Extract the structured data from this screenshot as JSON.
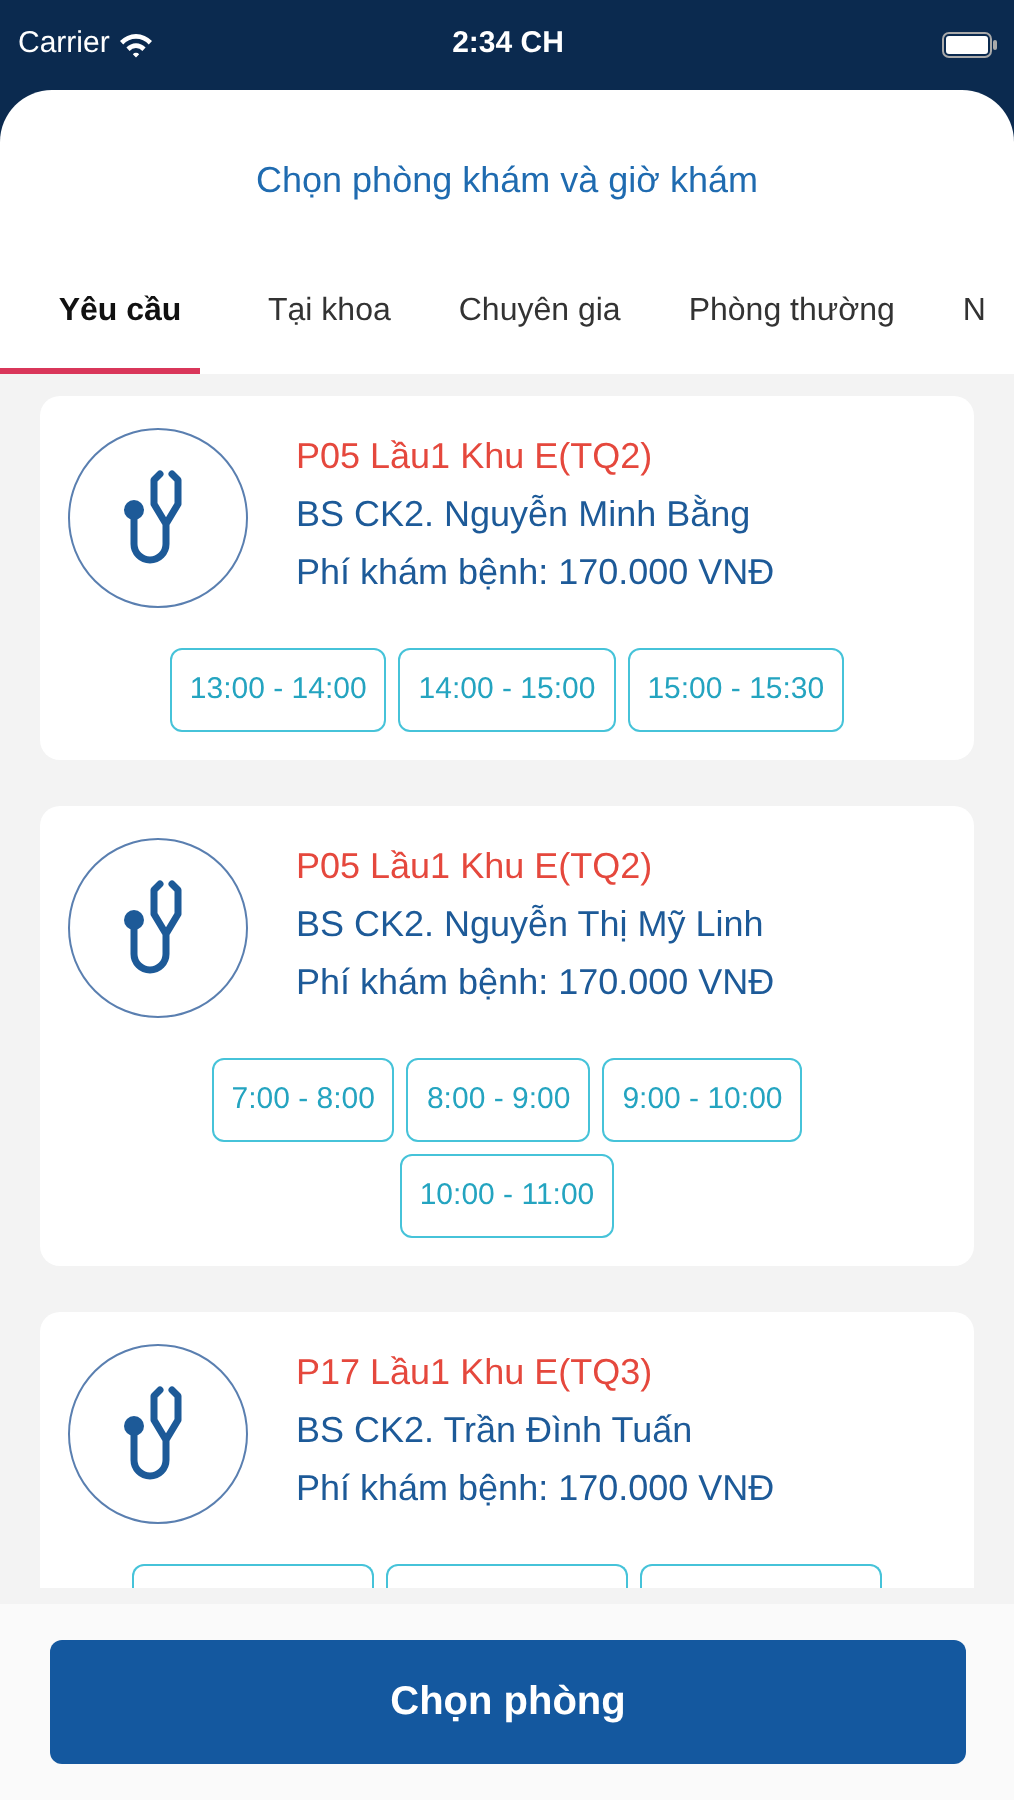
{
  "status_bar": {
    "carrier": "Carrier",
    "time": "2:34 CH"
  },
  "title": "Chọn phòng khám và giờ khám",
  "tabs": [
    {
      "label": "Yêu cầu",
      "selected": true
    },
    {
      "label": "Tại khoa",
      "selected": false
    },
    {
      "label": "Chuyên gia",
      "selected": false
    },
    {
      "label": "Phòng thường",
      "selected": false
    },
    {
      "label": "N",
      "selected": false
    }
  ],
  "rooms": [
    {
      "room": "P05 Lầu1 Khu E(TQ2)",
      "doctor": "BS CK2.  Nguyễn Minh Bằng",
      "fee": "Phí khám bệnh: 170.000 VNĐ",
      "slots": [
        {
          "kind": "time",
          "label": "13:00 - 14:00"
        },
        {
          "kind": "time",
          "label": "14:00 - 15:00"
        },
        {
          "kind": "time",
          "label": "15:00 - 15:30"
        }
      ]
    },
    {
      "room": "P05 Lầu1 Khu E(TQ2)",
      "doctor": "BS CK2. Nguyễn Thị Mỹ Linh",
      "fee": "Phí khám bệnh: 170.000 VNĐ",
      "slots": [
        {
          "kind": "time",
          "label": "7:00 - 8:00"
        },
        {
          "kind": "time",
          "label": "8:00 - 9:00"
        },
        {
          "kind": "time",
          "label": "9:00 - 10:00"
        },
        {
          "kind": "time",
          "label": "10:00 - 11:00"
        }
      ]
    },
    {
      "room": "P17 Lầu1 Khu E(TQ3)",
      "doctor": "BS CK2. Trần Đình Tuấn",
      "fee": "Phí khám bệnh: 170.000 VNĐ",
      "slots": [
        {
          "kind": "hidden"
        },
        {
          "kind": "hidden"
        },
        {
          "kind": "hidden"
        }
      ]
    }
  ],
  "button": "Chọn phòng"
}
